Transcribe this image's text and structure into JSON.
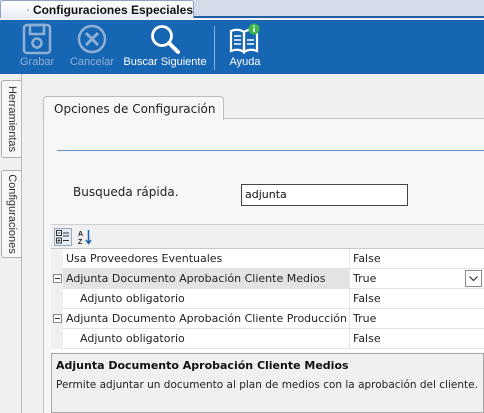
{
  "window_tab": {
    "title": "Configuraciones Especiales"
  },
  "toolbar": {
    "items": [
      {
        "label": "Grabar",
        "icon": "save-icon",
        "enabled": false
      },
      {
        "label": "Cancelar",
        "icon": "cancel-icon",
        "enabled": false
      },
      {
        "label": "Buscar Siguiente",
        "icon": "search-icon",
        "enabled": true
      },
      {
        "label": "Ayuda",
        "icon": "help-book-icon",
        "enabled": true
      }
    ]
  },
  "side_tabs": [
    {
      "label": "Herramientas"
    },
    {
      "label": "Configuraciones"
    }
  ],
  "panel": {
    "tab_label": "Opciones de Configuración"
  },
  "search": {
    "label": "Busqueda rápida.",
    "value": "adjunta"
  },
  "grid_toolbar": {
    "categorized_icon": "categorized-view-icon",
    "alphabetical_icon": "sort-alphabetical-icon"
  },
  "property_grid": {
    "rows": [
      {
        "name": "Usa Proveedores Eventuales",
        "value": "False",
        "kind": "top"
      },
      {
        "name": "Adjunta Documento Aprobación Cliente Medios",
        "value": "True",
        "kind": "category",
        "selected": true
      },
      {
        "name": "Adjunto obligatorio",
        "value": "False",
        "kind": "sub"
      },
      {
        "name": "Adjunta Documento Aprobación Cliente Producción",
        "value": "True",
        "kind": "category"
      },
      {
        "name": "Adjunto obligatorio",
        "value": "False",
        "kind": "sub"
      }
    ]
  },
  "help": {
    "title": "Adjunta Documento Aprobación Cliente Medios",
    "description": "Permite adjuntar un documento al plan de medios con la aprobación del cliente."
  },
  "colors": {
    "toolbar_bg": "#1766b4",
    "accent": "#1e5fa6"
  }
}
